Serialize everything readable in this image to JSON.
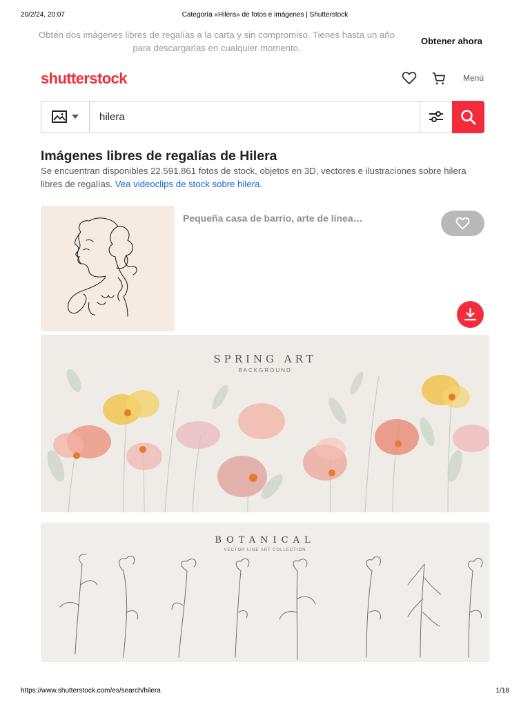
{
  "print_header": {
    "datetime": "20/2/24, 20:07",
    "document_title": "Categoría «Hilera» de fotos e imágenes | Shutterstock"
  },
  "promo": {
    "text": "Obtén dos imágenes libres de regalías a la carta y sin compromiso. Tienes hasta un año para descargarlas en cualquier momento.",
    "cta_label": "Obtener ahora"
  },
  "header": {
    "logo_text": "shutterstock",
    "menu_label": "Menú",
    "icons": [
      "heart-icon",
      "cart-icon"
    ]
  },
  "search": {
    "type_icon": "image-icon",
    "query": "hilera",
    "filter_icon": "filter-sliders-icon",
    "submit_icon": "search-icon"
  },
  "content": {
    "heading": "Imágenes libres de regalías de Hilera",
    "description": "Se encuentran disponibles 22.591.861 fotos de stock, objetos en 3D, vectores e ilustraciones sobre hilera libres de regalías.",
    "video_link_label": "Vea videoclips de stock sobre hilera."
  },
  "results": [
    {
      "caption": "Pequeña casa de barrio, arte de línea…",
      "favorite_icon": "heart-icon",
      "download_icon": "download-icon"
    },
    {
      "image_title": "SPRING ART",
      "image_subtitle": "BACKGROUND"
    },
    {
      "image_title": "BOTANICAL",
      "image_subtitle": "VECTOR LINE ART COLLECTION"
    }
  ],
  "colors": {
    "brand": "#f32c3c",
    "link": "#0b66d6",
    "muted_text": "#9a9a9a"
  },
  "print_footer": {
    "url": "https://www.shutterstock.com/es/search/hilera",
    "page": "1/18"
  }
}
